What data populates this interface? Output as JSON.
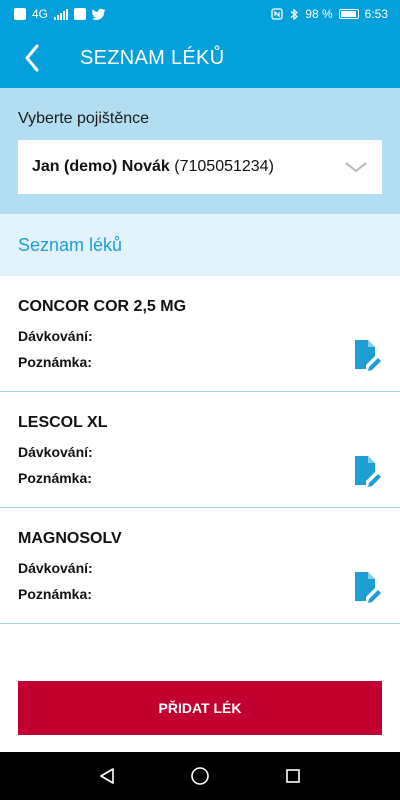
{
  "status_bar": {
    "network_label": "4G",
    "battery_percent": "98 %",
    "time": "6:53"
  },
  "header": {
    "title": "SEZNAM LÉKŮ"
  },
  "insured_selector": {
    "label": "Vyberte pojištěnce",
    "selected_name": "Jan (demo) Novák",
    "selected_id": "(7105051234)"
  },
  "list_section": {
    "title": "Seznam léků"
  },
  "drugs": [
    {
      "name": "CONCOR COR 2,5 MG",
      "dosage_label": "Dávkování:",
      "note_label": "Poznámka:"
    },
    {
      "name": "LESCOL XL",
      "dosage_label": "Dávkování:",
      "note_label": "Poznámka:"
    },
    {
      "name": "MAGNOSOLV",
      "dosage_label": "Dávkování:",
      "note_label": "Poznámka:"
    }
  ],
  "actions": {
    "add_label": "PŘIDAT LÉK"
  },
  "colors": {
    "primary": "#03a0dc",
    "panel": "#b3ddf0",
    "section": "#e2f2fa",
    "accent_text": "#1d9fd4",
    "add_button": "#c1002f"
  },
  "icons": {
    "back": "chevron-left-icon",
    "dropdown": "chevron-down-icon",
    "edit": "edit-document-icon",
    "nav_back": "triangle-back-icon",
    "nav_home": "circle-home-icon",
    "nav_recents": "square-recents-icon"
  }
}
